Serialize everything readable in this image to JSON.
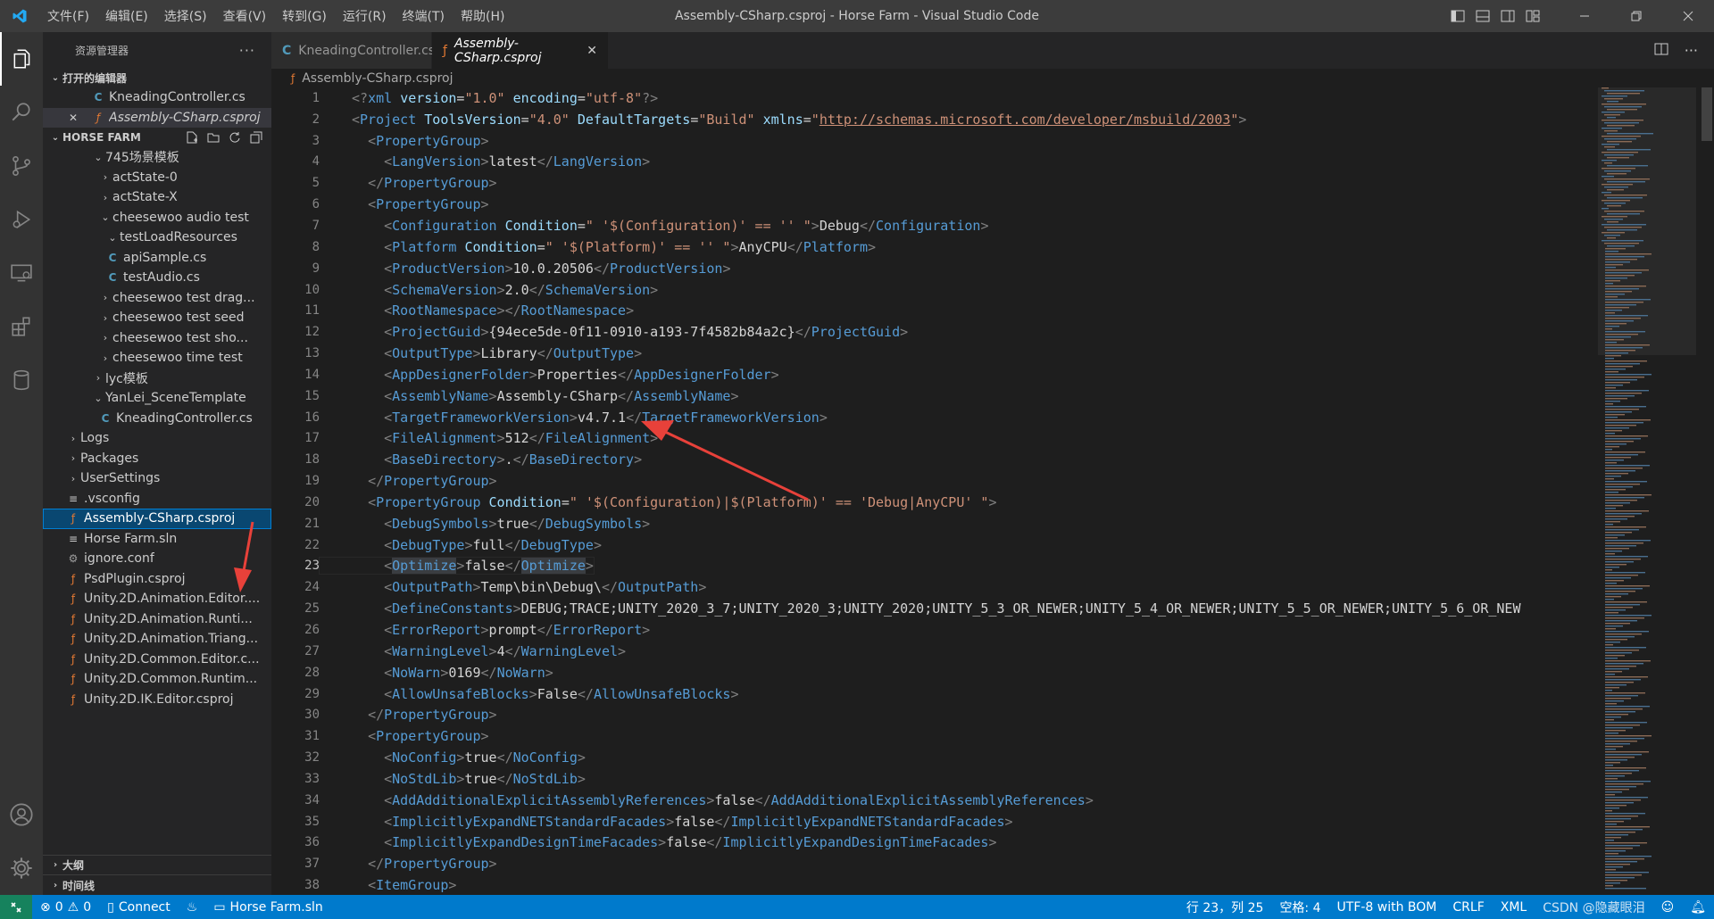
{
  "titlebar": {
    "menu": [
      "文件(F)",
      "编辑(E)",
      "选择(S)",
      "查看(V)",
      "转到(G)",
      "运行(R)",
      "终端(T)",
      "帮助(H)"
    ],
    "title": "Assembly-CSharp.csproj - Horse Farm - Visual Studio Code"
  },
  "sidebar": {
    "title": "资源管理器",
    "open_editors_title": "打开的编辑器",
    "open_editors": [
      "KneadingController.cs",
      "Assembly-CSharp.csproj"
    ],
    "project_title": "HORSE FARM",
    "tree": [
      {
        "label": "745场景模板",
        "chev": "v",
        "icon": ""
      },
      {
        "label": "actState-0",
        "chev": ">",
        "icon": ""
      },
      {
        "label": "actState-X",
        "chev": ">",
        "icon": ""
      },
      {
        "label": "cheesewoo audio test",
        "chev": "v",
        "icon": ""
      },
      {
        "label": "testLoadResources",
        "chev": "v",
        "icon": ""
      },
      {
        "label": "apiSample.cs",
        "chev": "",
        "icon": "C"
      },
      {
        "label": "testAudio.cs",
        "chev": "",
        "icon": "C"
      },
      {
        "label": "cheesewoo test drag...",
        "chev": ">",
        "icon": ""
      },
      {
        "label": "cheesewoo test seed",
        "chev": ">",
        "icon": ""
      },
      {
        "label": "cheesewoo test sho...",
        "chev": ">",
        "icon": ""
      },
      {
        "label": "cheesewoo time test",
        "chev": ">",
        "icon": ""
      },
      {
        "label": "lyc模板",
        "chev": ">",
        "icon": ""
      },
      {
        "label": "YanLei_SceneTemplate",
        "chev": "v",
        "icon": ""
      },
      {
        "label": "KneadingController.cs",
        "chev": "",
        "icon": "C"
      },
      {
        "label": "Logs",
        "chev": ">",
        "icon": ""
      },
      {
        "label": "Packages",
        "chev": ">",
        "icon": ""
      },
      {
        "label": "UserSettings",
        "chev": ">",
        "icon": ""
      },
      {
        "label": ".vsconfig",
        "chev": "",
        "icon": "≡"
      },
      {
        "label": "Assembly-CSharp.csproj",
        "chev": "",
        "icon": "rss"
      },
      {
        "label": "Horse Farm.sln",
        "chev": "",
        "icon": "≡"
      },
      {
        "label": "ignore.conf",
        "chev": "",
        "icon": "⚙"
      },
      {
        "label": "PsdPlugin.csproj",
        "chev": "",
        "icon": "rss"
      },
      {
        "label": "Unity.2D.Animation.Editor....",
        "chev": "",
        "icon": "rss"
      },
      {
        "label": "Unity.2D.Animation.Runti...",
        "chev": "",
        "icon": "rss"
      },
      {
        "label": "Unity.2D.Animation.Triang...",
        "chev": "",
        "icon": "rss"
      },
      {
        "label": "Unity.2D.Common.Editor.c...",
        "chev": "",
        "icon": "rss"
      },
      {
        "label": "Unity.2D.Common.Runtim...",
        "chev": "",
        "icon": "rss"
      },
      {
        "label": "Unity.2D.IK.Editor.csproj",
        "chev": "",
        "icon": "rss"
      }
    ],
    "outline_title": "大纲",
    "timeline_title": "时间线"
  },
  "tabs": [
    {
      "label": "KneadingController.cs",
      "icon": "C"
    },
    {
      "label": "Assembly-CSharp.csproj",
      "icon": "rss"
    }
  ],
  "breadcrumb": "Assembly-CSharp.csproj",
  "code": {
    "lines": [
      "1",
      "2",
      "3",
      "4",
      "5",
      "6",
      "7",
      "8",
      "9",
      "10",
      "11",
      "12",
      "13",
      "14",
      "15",
      "16",
      "17",
      "18",
      "19",
      "20",
      "21",
      "22",
      "23",
      "24",
      "25",
      "26",
      "27",
      "28",
      "29",
      "30",
      "31",
      "32",
      "33",
      "34",
      "35",
      "36",
      "37",
      "38"
    ],
    "current_line": "23",
    "project_url": "http://schemas.microsoft.com/developer/msbuild/2003",
    "project_guid": "{94ece5de-0f11-0910-a193-7f4582b84a2c}",
    "product_version": "10.0.20506",
    "target_framework": "v4.7.1",
    "define_constants": "DEBUG;TRACE;UNITY_2020_3_7;UNITY_2020_3;UNITY_2020;UNITY_5_3_OR_NEWER;UNITY_5_4_OR_NEWER;UNITY_5_5_OR_NEWER;UNITY_5_6_OR_NEW"
  },
  "statusbar": {
    "errors": "0",
    "warnings": "0",
    "connect": "Connect",
    "solution": "Horse Farm.sln",
    "position": "行 23，列 25",
    "spaces": "空格: 4",
    "encoding": "UTF-8 with BOM",
    "eol": "CRLF",
    "language": "XML",
    "watermark": "CSDN @隐藏眼泪"
  },
  "colors": {
    "accent": "#007acc",
    "arrow": "#e8413a",
    "tag": "#569cd6",
    "attribute": "#9cdcfe",
    "string": "#ce9178"
  }
}
